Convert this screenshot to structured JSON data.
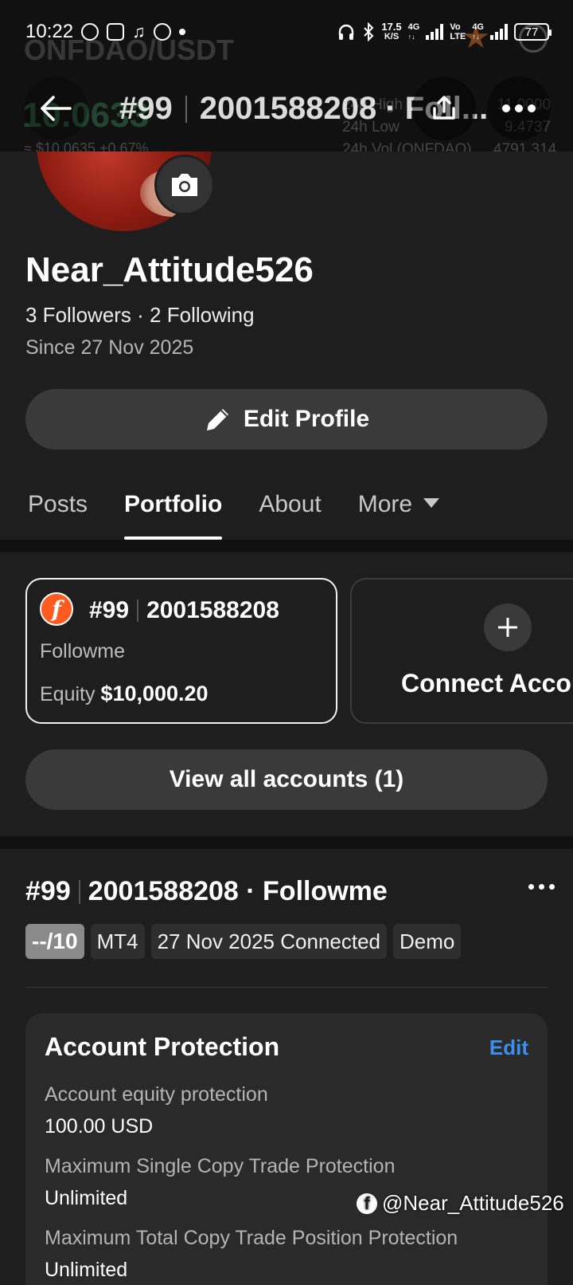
{
  "status_bar": {
    "time": "10:22",
    "net_speed_value": "17.5",
    "net_speed_unit": "K/S",
    "net1": "4G",
    "net2_top": "Vo",
    "net2_bottom": "LTE",
    "net3": "4G",
    "battery": "77"
  },
  "background_ghost": {
    "pair": "ONFDAO/USDT",
    "price": "10.0633",
    "sub": "≈ $10.0635  +0.67%",
    "stats_labels": [
      "24h High",
      "24h Low",
      "24h Vol (ONFDAO)"
    ],
    "stats_values": [
      "11.0000",
      "9.4737",
      "4791.314"
    ]
  },
  "nav": {
    "title_number": "#99",
    "title_rest": "2001588208 · Foll..."
  },
  "profile": {
    "username": "Near_Attitude526",
    "followers": "3 Followers · 2 Following",
    "since": "Since 27 Nov 2025",
    "edit_label": "Edit Profile"
  },
  "tabs": [
    {
      "label": "Posts"
    },
    {
      "label": "Portfolio"
    },
    {
      "label": "About"
    },
    {
      "label": "More"
    }
  ],
  "account_card": {
    "number": "#99",
    "id": "2001588208",
    "platform": "Followme",
    "equity_label": "Equity",
    "equity_value": "$10,000.20"
  },
  "connect_card": {
    "label": "Connect Account"
  },
  "view_all_label": "View all accounts (1)",
  "detail": {
    "number": "#99",
    "title_rest": "2001588208 · Followme",
    "score": "--/10",
    "chips": [
      "MT4",
      "27 Nov 2025 Connected",
      "Demo"
    ]
  },
  "protection": {
    "title": "Account Protection",
    "edit": "Edit",
    "rows": [
      {
        "label": "Account equity protection",
        "value": "100.00 USD"
      },
      {
        "label": "Maximum Single Copy Trade Protection",
        "value": "Unlimited"
      },
      {
        "label": "Maximum Total Copy Trade Position Protection",
        "value": "Unlimited"
      }
    ]
  },
  "watermark": "@Near_Attitude526",
  "colors": {
    "accent_link": "#3b8ff0",
    "followme_brand": "#ff5a1f",
    "background": "#1e1e1e"
  }
}
